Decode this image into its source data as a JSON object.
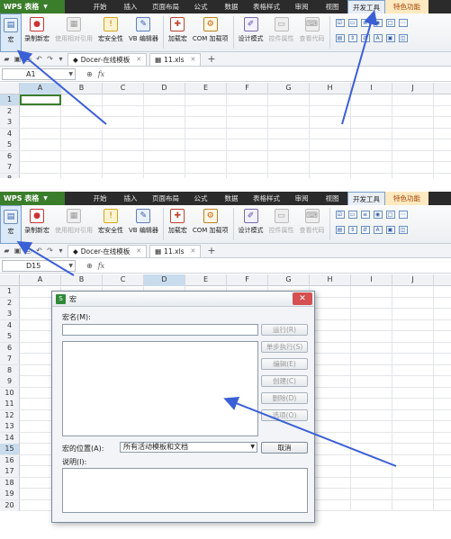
{
  "app": {
    "logo_text": "WPS 表格",
    "menu_tabs": [
      "开始",
      "插入",
      "页面布局",
      "公式",
      "数据",
      "表格样式",
      "审阅",
      "视图",
      "开发工具",
      "特色功能"
    ]
  },
  "ribbon": {
    "macro": "宏",
    "record_macro": "录制新宏",
    "relative_ref": "使用相对引用",
    "macro_security": "宏安全性",
    "vb_editor": "VB 编辑器",
    "addins": "加载宏",
    "com_addins": "COM 加载项",
    "design_mode": "设计模式",
    "control_props": "控件属性",
    "view_code": "查看代码"
  },
  "doc_tabs": [
    "Docer-在线模板",
    "11.xls"
  ],
  "top": {
    "namebox": "A1",
    "active_row": 1,
    "active_col": "A"
  },
  "bottom": {
    "namebox": "D15",
    "active_row": 15,
    "active_col": "D"
  },
  "columns": [
    "A",
    "B",
    "C",
    "D",
    "E",
    "F",
    "G",
    "H",
    "I",
    "J"
  ],
  "top_rows": [
    1,
    2,
    3,
    4,
    5,
    6,
    7,
    8
  ],
  "bottom_rows": [
    1,
    2,
    3,
    4,
    5,
    6,
    7,
    8,
    9,
    10,
    11,
    12,
    13,
    14,
    15,
    16,
    17,
    18,
    19,
    20
  ],
  "dialog": {
    "title": "宏",
    "macro_name_label": "宏名(M):",
    "macro_name_value": "",
    "location_label": "宏的位置(A):",
    "location_value": "所有活动模板和文档",
    "description_label": "说明(I):",
    "buttons": [
      "运行(R)",
      "单步执行(S)",
      "编辑(E)",
      "创建(C)",
      "删除(D)",
      "选项(O)"
    ],
    "cancel": "取消"
  }
}
